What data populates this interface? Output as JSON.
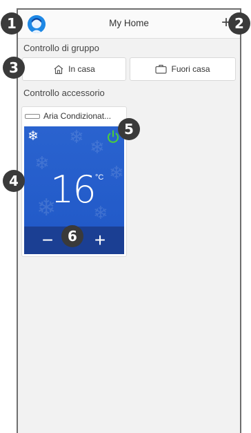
{
  "header": {
    "title": "My Home",
    "add_label": "+"
  },
  "group_control": {
    "label": "Controllo di gruppo",
    "buttons": [
      {
        "label": "In casa",
        "icon": "house-icon"
      },
      {
        "label": "Fuori casa",
        "icon": "suitcase-icon"
      }
    ]
  },
  "accessory_control": {
    "label": "Controllo accessorio"
  },
  "device": {
    "name": "Aria Condizionat...",
    "temperature": "16",
    "unit": "°C",
    "mode_icon": "snowflake-icon",
    "power_color": "#4cd137",
    "minus_label": "−",
    "plus_label": "+"
  },
  "badges": [
    "1",
    "2",
    "3",
    "4",
    "5",
    "6"
  ],
  "colors": {
    "panel_blue": "#2258c8",
    "control_bar": "#1b3f93",
    "badge": "#3a3a3a"
  }
}
